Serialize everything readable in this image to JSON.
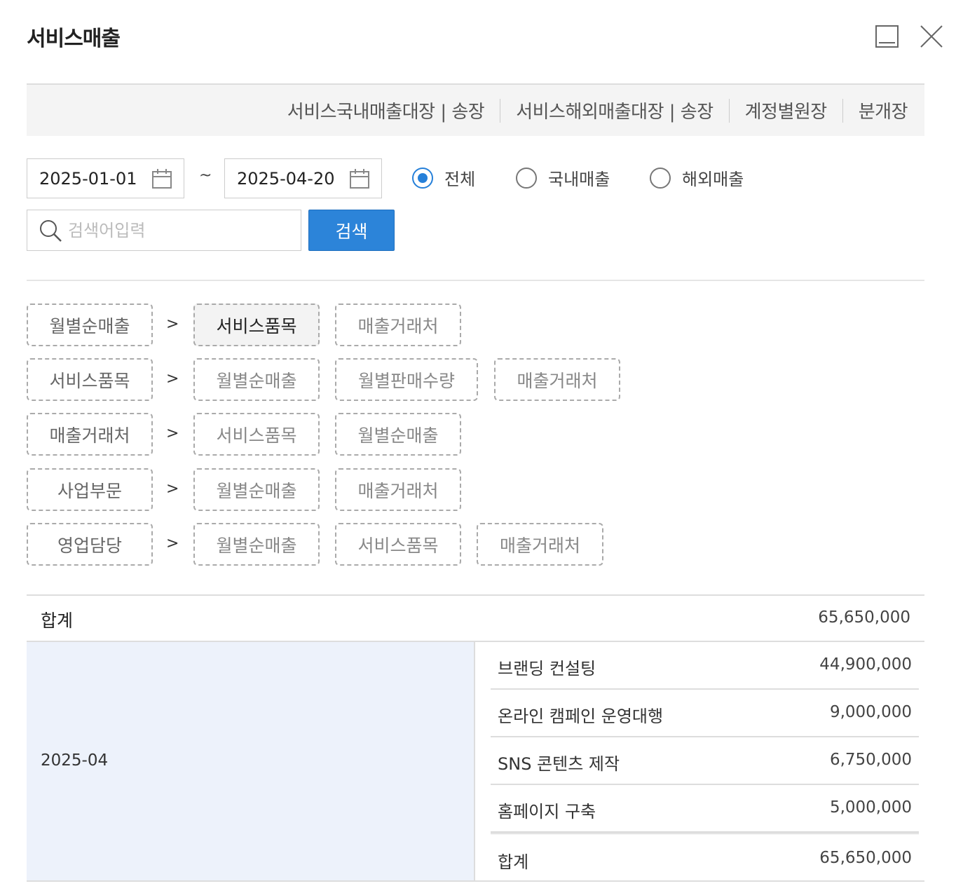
{
  "window": {
    "title": "서비스매출"
  },
  "top_links": [
    "서비스국내매출대장 | 송장",
    "서비스해외매출대장 | 송장",
    "계정별원장",
    "분개장"
  ],
  "filter": {
    "date_from": "2025-01-01",
    "date_to": "2025-04-20",
    "range_separator": "~",
    "radios": [
      {
        "label": "전체",
        "checked": true
      },
      {
        "label": "국내매출",
        "checked": false
      },
      {
        "label": "해외매출",
        "checked": false
      }
    ],
    "search_placeholder": "검색어입력",
    "search_value": "",
    "search_button": "검색"
  },
  "drill_paths": [
    {
      "head": "월별순매출",
      "items": [
        "서비스품목",
        "매출거래처"
      ],
      "active_item": 0
    },
    {
      "head": "서비스품목",
      "items": [
        "월별순매출",
        "월별판매수량",
        "매출거래처"
      ]
    },
    {
      "head": "매출거래처",
      "items": [
        "서비스품목",
        "월별순매출"
      ]
    },
    {
      "head": "사업부문",
      "items": [
        "월별순매출",
        "매출거래처"
      ]
    },
    {
      "head": "영업담당",
      "items": [
        "월별순매출",
        "서비스품목",
        "매출거래처"
      ]
    }
  ],
  "drill_arrow": ">",
  "summary": {
    "label": "합계",
    "value": "65,650,000",
    "month": "2025-04",
    "rows": [
      {
        "name": "브랜딩 컨설팅",
        "amount": "44,900,000"
      },
      {
        "name": "온라인 캠페인 운영대행",
        "amount": "9,000,000"
      },
      {
        "name": "SNS 콘텐츠 제작",
        "amount": "6,750,000"
      },
      {
        "name": "홈페이지 구축",
        "amount": "5,000,000"
      }
    ],
    "month_total_label": "합계",
    "month_total_value": "65,650,000"
  },
  "colors": {
    "accent": "#2c84d9",
    "month_bg": "#edf2fb"
  }
}
